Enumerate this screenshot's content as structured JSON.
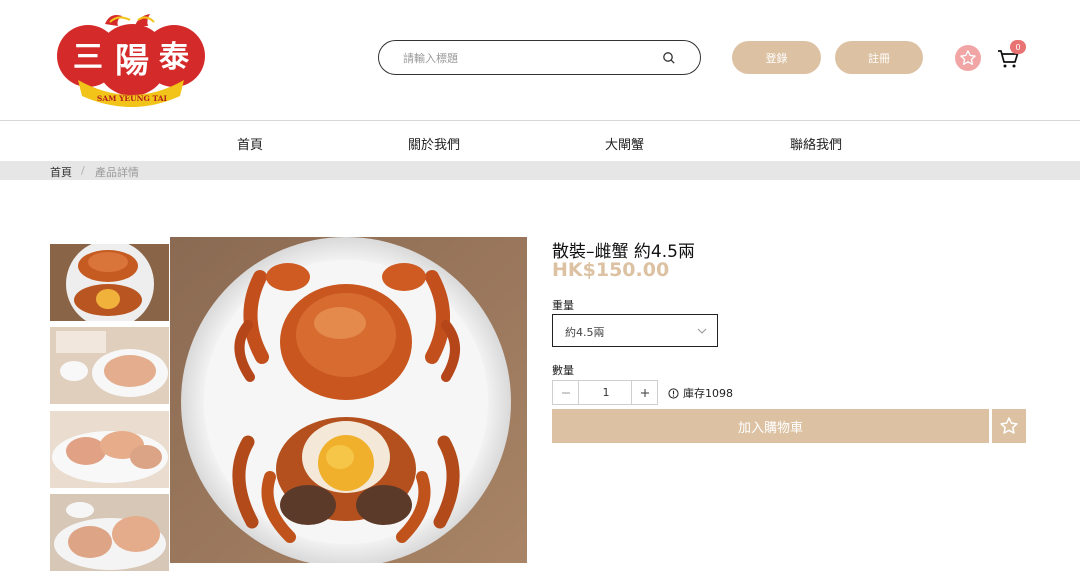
{
  "brand": {
    "logo_chars": [
      "三",
      "陽",
      "泰"
    ],
    "logo_subtitle": "SAM YEUNG TAI"
  },
  "header": {
    "search_placeholder": "請輸入標題",
    "login_label": "登錄",
    "register_label": "註冊",
    "cart_count": "0"
  },
  "nav": {
    "items": [
      {
        "label": "首頁"
      },
      {
        "label": "關於我們"
      },
      {
        "label": "大閘蟹"
      },
      {
        "label": "聯絡我們"
      }
    ]
  },
  "breadcrumb": {
    "home": "首頁",
    "separator": "/",
    "current": "產品詳情"
  },
  "product": {
    "title": "散裝–雌蟹 約4.5兩",
    "price": "HK$150.00",
    "weight_label": "重量",
    "weight_value": "約4.5兩",
    "quantity_label": "數量",
    "quantity_value": "1",
    "stock_text": "庫存1098",
    "add_to_cart_label": "加入購物車"
  },
  "colors": {
    "accent": "#dcc2a2",
    "badge": "#e97373",
    "logo_red": "#d42a2a",
    "logo_gold": "#f2c318"
  },
  "icons": [
    "search-icon",
    "star-icon",
    "cart-icon",
    "chevron-down-icon",
    "info-icon",
    "minus-icon",
    "plus-icon"
  ]
}
